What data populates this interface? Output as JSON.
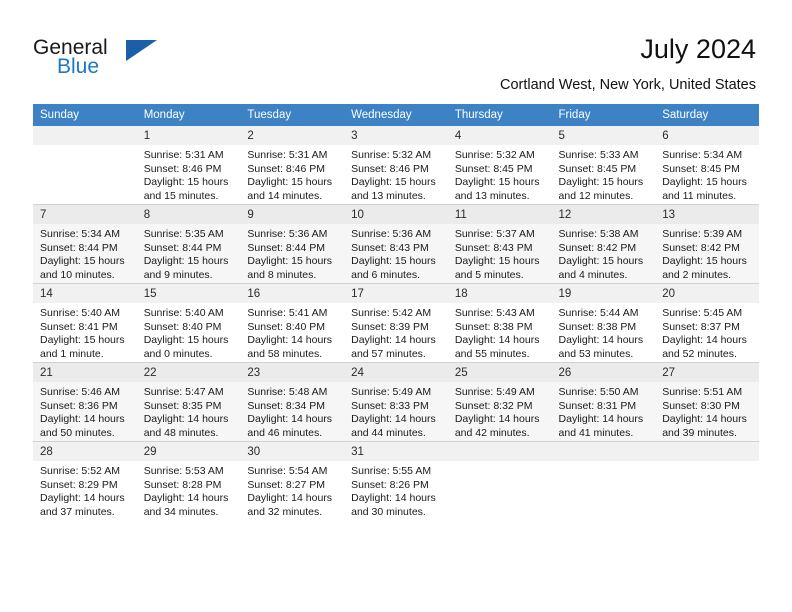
{
  "brand": {
    "name_part1": "General",
    "name_part2": "Blue",
    "flag_icon": "triangle-flag-icon"
  },
  "header": {
    "title": "July 2024",
    "subtitle": "Cortland West, New York, United States"
  },
  "colors": {
    "header_blue": "#3c82c4",
    "brand_blue": "#1b79c3",
    "flag_blue": "#1b5fa8",
    "daynum_bg": "#f1f1f1",
    "band_bg": "#f6f6f6"
  },
  "weekdays": [
    "Sunday",
    "Monday",
    "Tuesday",
    "Wednesday",
    "Thursday",
    "Friday",
    "Saturday"
  ],
  "weeks": [
    {
      "shaded": false,
      "days": [
        {
          "num": "",
          "lines": []
        },
        {
          "num": "1",
          "lines": [
            "Sunrise: 5:31 AM",
            "Sunset: 8:46 PM",
            "Daylight: 15 hours",
            "and 15 minutes."
          ]
        },
        {
          "num": "2",
          "lines": [
            "Sunrise: 5:31 AM",
            "Sunset: 8:46 PM",
            "Daylight: 15 hours",
            "and 14 minutes."
          ]
        },
        {
          "num": "3",
          "lines": [
            "Sunrise: 5:32 AM",
            "Sunset: 8:46 PM",
            "Daylight: 15 hours",
            "and 13 minutes."
          ]
        },
        {
          "num": "4",
          "lines": [
            "Sunrise: 5:32 AM",
            "Sunset: 8:45 PM",
            "Daylight: 15 hours",
            "and 13 minutes."
          ]
        },
        {
          "num": "5",
          "lines": [
            "Sunrise: 5:33 AM",
            "Sunset: 8:45 PM",
            "Daylight: 15 hours",
            "and 12 minutes."
          ]
        },
        {
          "num": "6",
          "lines": [
            "Sunrise: 5:34 AM",
            "Sunset: 8:45 PM",
            "Daylight: 15 hours",
            "and 11 minutes."
          ]
        }
      ]
    },
    {
      "shaded": true,
      "days": [
        {
          "num": "7",
          "lines": [
            "Sunrise: 5:34 AM",
            "Sunset: 8:44 PM",
            "Daylight: 15 hours",
            "and 10 minutes."
          ]
        },
        {
          "num": "8",
          "lines": [
            "Sunrise: 5:35 AM",
            "Sunset: 8:44 PM",
            "Daylight: 15 hours",
            "and 9 minutes."
          ]
        },
        {
          "num": "9",
          "lines": [
            "Sunrise: 5:36 AM",
            "Sunset: 8:44 PM",
            "Daylight: 15 hours",
            "and 8 minutes."
          ]
        },
        {
          "num": "10",
          "lines": [
            "Sunrise: 5:36 AM",
            "Sunset: 8:43 PM",
            "Daylight: 15 hours",
            "and 6 minutes."
          ]
        },
        {
          "num": "11",
          "lines": [
            "Sunrise: 5:37 AM",
            "Sunset: 8:43 PM",
            "Daylight: 15 hours",
            "and 5 minutes."
          ]
        },
        {
          "num": "12",
          "lines": [
            "Sunrise: 5:38 AM",
            "Sunset: 8:42 PM",
            "Daylight: 15 hours",
            "and 4 minutes."
          ]
        },
        {
          "num": "13",
          "lines": [
            "Sunrise: 5:39 AM",
            "Sunset: 8:42 PM",
            "Daylight: 15 hours",
            "and 2 minutes."
          ]
        }
      ]
    },
    {
      "shaded": false,
      "days": [
        {
          "num": "14",
          "lines": [
            "Sunrise: 5:40 AM",
            "Sunset: 8:41 PM",
            "Daylight: 15 hours",
            "and 1 minute."
          ]
        },
        {
          "num": "15",
          "lines": [
            "Sunrise: 5:40 AM",
            "Sunset: 8:40 PM",
            "Daylight: 15 hours",
            "and 0 minutes."
          ]
        },
        {
          "num": "16",
          "lines": [
            "Sunrise: 5:41 AM",
            "Sunset: 8:40 PM",
            "Daylight: 14 hours",
            "and 58 minutes."
          ]
        },
        {
          "num": "17",
          "lines": [
            "Sunrise: 5:42 AM",
            "Sunset: 8:39 PM",
            "Daylight: 14 hours",
            "and 57 minutes."
          ]
        },
        {
          "num": "18",
          "lines": [
            "Sunrise: 5:43 AM",
            "Sunset: 8:38 PM",
            "Daylight: 14 hours",
            "and 55 minutes."
          ]
        },
        {
          "num": "19",
          "lines": [
            "Sunrise: 5:44 AM",
            "Sunset: 8:38 PM",
            "Daylight: 14 hours",
            "and 53 minutes."
          ]
        },
        {
          "num": "20",
          "lines": [
            "Sunrise: 5:45 AM",
            "Sunset: 8:37 PM",
            "Daylight: 14 hours",
            "and 52 minutes."
          ]
        }
      ]
    },
    {
      "shaded": true,
      "days": [
        {
          "num": "21",
          "lines": [
            "Sunrise: 5:46 AM",
            "Sunset: 8:36 PM",
            "Daylight: 14 hours",
            "and 50 minutes."
          ]
        },
        {
          "num": "22",
          "lines": [
            "Sunrise: 5:47 AM",
            "Sunset: 8:35 PM",
            "Daylight: 14 hours",
            "and 48 minutes."
          ]
        },
        {
          "num": "23",
          "lines": [
            "Sunrise: 5:48 AM",
            "Sunset: 8:34 PM",
            "Daylight: 14 hours",
            "and 46 minutes."
          ]
        },
        {
          "num": "24",
          "lines": [
            "Sunrise: 5:49 AM",
            "Sunset: 8:33 PM",
            "Daylight: 14 hours",
            "and 44 minutes."
          ]
        },
        {
          "num": "25",
          "lines": [
            "Sunrise: 5:49 AM",
            "Sunset: 8:32 PM",
            "Daylight: 14 hours",
            "and 42 minutes."
          ]
        },
        {
          "num": "26",
          "lines": [
            "Sunrise: 5:50 AM",
            "Sunset: 8:31 PM",
            "Daylight: 14 hours",
            "and 41 minutes."
          ]
        },
        {
          "num": "27",
          "lines": [
            "Sunrise: 5:51 AM",
            "Sunset: 8:30 PM",
            "Daylight: 14 hours",
            "and 39 minutes."
          ]
        }
      ]
    },
    {
      "shaded": false,
      "days": [
        {
          "num": "28",
          "lines": [
            "Sunrise: 5:52 AM",
            "Sunset: 8:29 PM",
            "Daylight: 14 hours",
            "and 37 minutes."
          ]
        },
        {
          "num": "29",
          "lines": [
            "Sunrise: 5:53 AM",
            "Sunset: 8:28 PM",
            "Daylight: 14 hours",
            "and 34 minutes."
          ]
        },
        {
          "num": "30",
          "lines": [
            "Sunrise: 5:54 AM",
            "Sunset: 8:27 PM",
            "Daylight: 14 hours",
            "and 32 minutes."
          ]
        },
        {
          "num": "31",
          "lines": [
            "Sunrise: 5:55 AM",
            "Sunset: 8:26 PM",
            "Daylight: 14 hours",
            "and 30 minutes."
          ]
        },
        {
          "num": "",
          "lines": []
        },
        {
          "num": "",
          "lines": []
        },
        {
          "num": "",
          "lines": []
        }
      ]
    }
  ]
}
